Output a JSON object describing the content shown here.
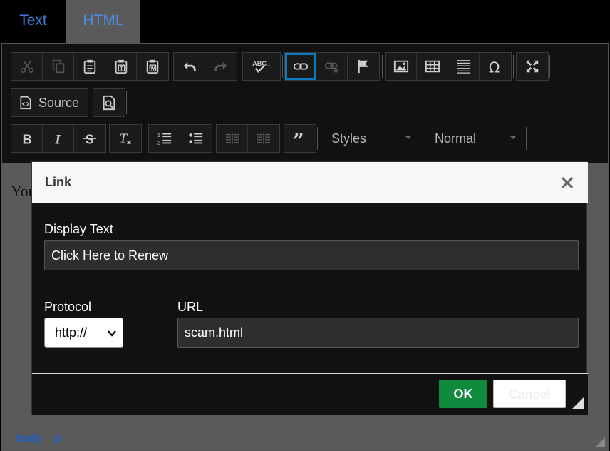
{
  "tabs": [
    {
      "label": "Text",
      "active": false
    },
    {
      "label": "HTML",
      "active": true
    }
  ],
  "toolbar": {
    "row1_icons": [
      "cut-icon",
      "copy-icon",
      "paste-icon",
      "paste-text-icon",
      "paste-word-icon",
      "undo-icon",
      "redo-icon",
      "spellcheck-icon",
      "link-icon",
      "unlink-icon",
      "anchor-icon",
      "image-icon",
      "table-icon",
      "horizontal-line-icon",
      "special-char-icon",
      "maximize-icon"
    ],
    "source_label": "Source",
    "styles_label": "Styles",
    "format_label": "Normal"
  },
  "content": {
    "text": "You"
  },
  "statusbar": {
    "path": [
      "body",
      "p"
    ]
  },
  "dialog": {
    "title": "Link",
    "display_text_label": "Display Text",
    "display_text_value": "Click Here to Renew",
    "protocol_label": "Protocol",
    "protocol_value": "http://",
    "url_label": "URL",
    "url_value": "scam.html",
    "ok_label": "OK",
    "cancel_label": "Cancel"
  },
  "colors": {
    "accent": "#0a7abf",
    "ok_green": "#108a3c",
    "tab_link": "#3b7dd8"
  }
}
